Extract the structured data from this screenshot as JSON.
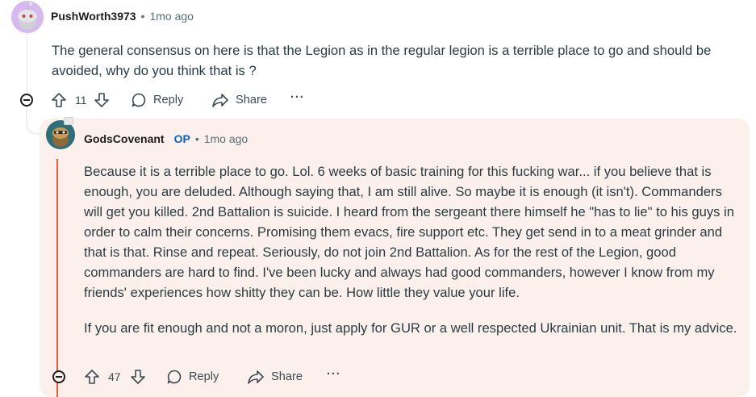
{
  "comment": {
    "username": "PushWorth3973",
    "separator": "•",
    "time": "1mo ago",
    "text": "The general consensus on here is that the Legion as in the regular legion is a terrible place to go and should be avoided, why do you think that is ?",
    "votes": "11",
    "reply_label": "Reply",
    "share_label": "Share",
    "more_label": "···"
  },
  "reply": {
    "username": "GodsCovenant",
    "op_badge": "OP",
    "separator": "•",
    "time": "1mo ago",
    "paragraph1": "Because it is a terrible place to go. Lol. 6 weeks of basic training for this fucking war... if you believe that is enough, you are deluded. Although saying that, I am still alive. So maybe it is enough (it isn't). Commanders will get you killed. 2nd Battalion is suicide. I heard from the sergeant there himself he \"has to lie\" to his guys in order to calm their concerns. Promising them evacs, fire support etc. They get send in to a meat grinder and that is that. Rinse and repeat. Seriously, do not join 2nd Battalion. As for the rest of the Legion, good commanders are hard to find. I've been lucky and always had good commanders, however I know from my friends' experiences how shitty they can be. How little they value your life.",
    "paragraph2": "If you are fit enough and not a moron, just apply for GUR or a well respected Ukrainian unit. That is my advice.",
    "votes": "47",
    "reply_label": "Reply",
    "share_label": "Share",
    "more_label": "···"
  },
  "colors": {
    "op_highlight": "#fcf0ed",
    "op_accent": "#e4603a",
    "op_badge": "#0a5fc7"
  }
}
